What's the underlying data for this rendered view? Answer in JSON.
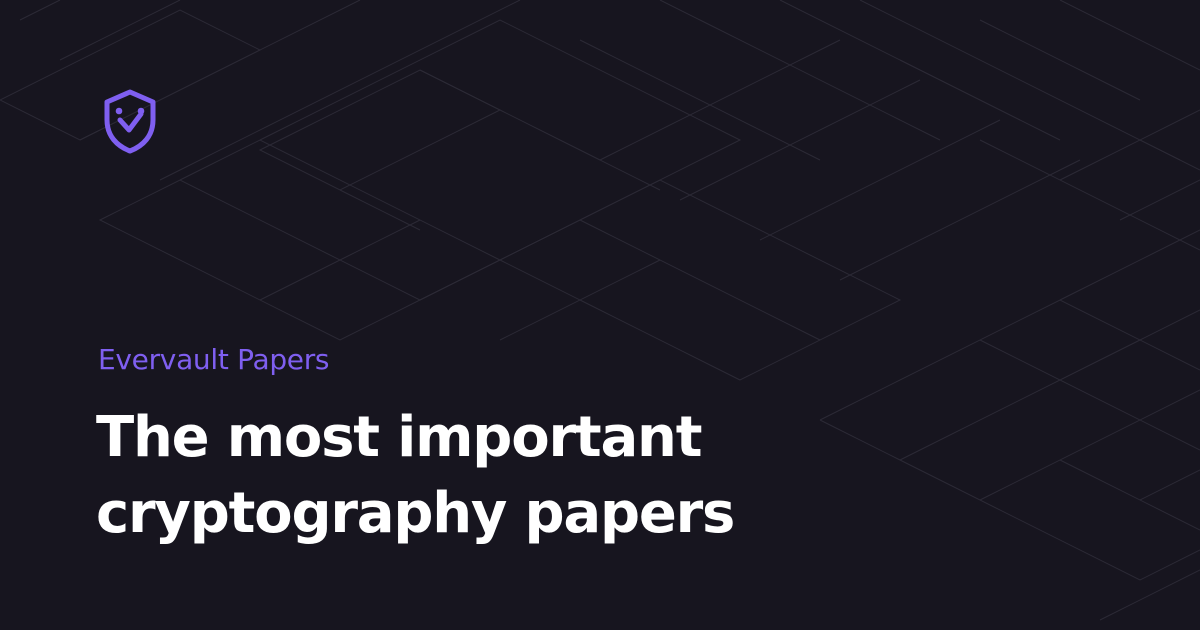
{
  "brand": {
    "eyebrow": "Evervault Papers",
    "accent_color": "#7f5ff0",
    "logo_icon": "shield-check-icon"
  },
  "headline": {
    "line1": "The most important",
    "line2": "cryptography papers",
    "color": "#ffffff"
  },
  "background": {
    "color": "#17151f",
    "grid_color": "#2c2a36"
  }
}
